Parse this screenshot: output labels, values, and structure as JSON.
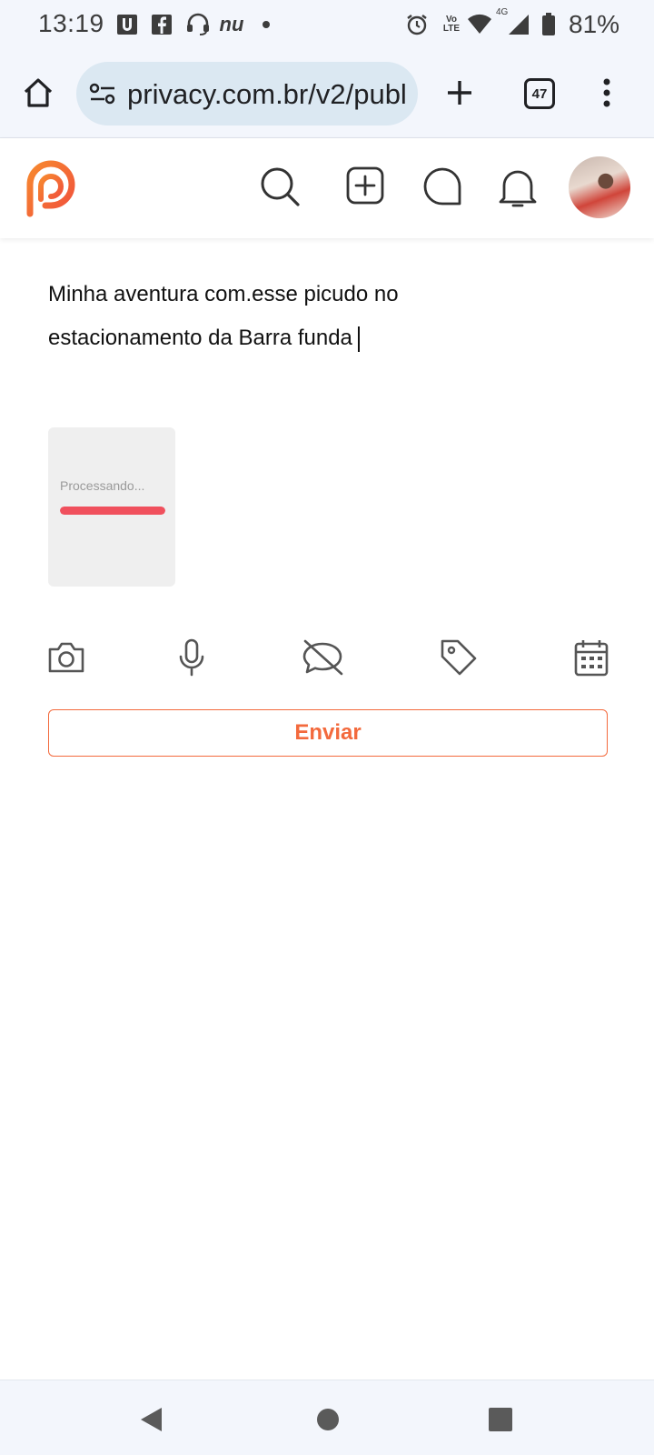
{
  "status_bar": {
    "time": "13:19",
    "battery": "81%",
    "icons": [
      "u-app-icon",
      "facebook-icon",
      "headset-icon",
      "nu-icon",
      "dot-icon",
      "alarm-icon",
      "volte-icon",
      "wifi-icon",
      "signal-4g-icon",
      "battery-icon"
    ],
    "nu_label": "nu",
    "volte_top": "Vo",
    "volte_bottom": "LTE",
    "network_type": "4G"
  },
  "browser": {
    "url": "privacy.com.br/v2/publ",
    "tab_count": "47",
    "icons": [
      "home-icon",
      "site-settings-icon",
      "new-tab-icon",
      "tabs-icon",
      "more-menu-icon"
    ]
  },
  "app_header": {
    "logo": "privacy-logo",
    "icons": [
      "search-icon",
      "add-post-icon",
      "chat-icon",
      "bell-icon"
    ],
    "brand_color": "#f36a3d"
  },
  "composer": {
    "text_line_1": "Minha aventura com.esse picudo no",
    "text_line_2": "estacionamento da Barra funda",
    "media": {
      "status_label": "Processando...",
      "progress": 1.0,
      "progress_color": "#f0505d"
    },
    "toolbar_icons": [
      "camera-icon",
      "microphone-icon",
      "comments-off-icon",
      "tag-icon",
      "calendar-icon"
    ],
    "send_label": "Enviar"
  },
  "nav_bar": {
    "icons": [
      "back-icon",
      "home-circle-icon",
      "recents-icon"
    ]
  }
}
